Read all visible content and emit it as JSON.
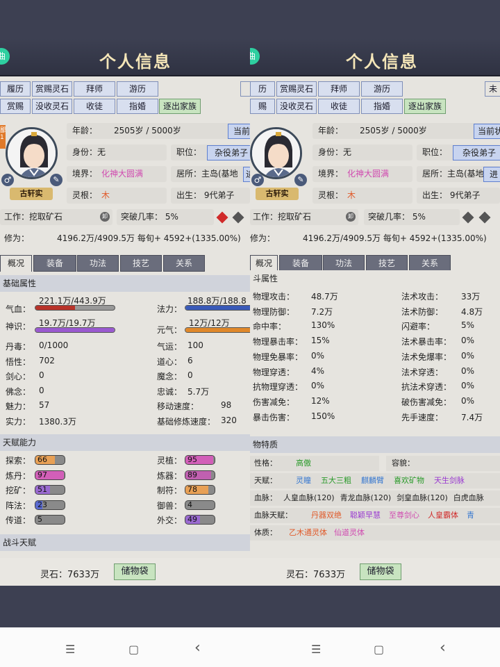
{
  "left": {
    "title": "个人信息",
    "edge_left": "曲",
    "toolbar_row1": [
      "履历",
      "赏赐灵石",
      "拜师",
      "游历"
    ],
    "toolbar_row2": [
      "赏赐",
      "没收灵石",
      "收徒",
      "指婚",
      "逐出家族"
    ],
    "corner_btn": "",
    "badge_left": "鄙",
    "badge_left2": "1",
    "name": "古轩实",
    "gender_icon": "♂",
    "age_label": "年龄：",
    "age_value": "2505岁 / 5000岁",
    "current_btn": "当前",
    "identity": "身份：无",
    "position_label": "职位：",
    "position_value": "杂役弟子",
    "realm_label": "境界：",
    "realm_value": "化神大圆满",
    "residence": "居所：主岛(基地",
    "residence_btn": "进",
    "root_label": "灵根：",
    "root_value": "木",
    "birth": "出生： 9代弟子",
    "work": "工作：挖取矿石",
    "work_icon": "卸",
    "breakthrough": "突破几率： 5%",
    "cultivation_label": "修为：",
    "cultivation_value": "4196.2万/4909.5万 每旬+ 4592+(1335.00%)",
    "tabs": [
      "概况",
      "装备",
      "功法",
      "技艺",
      "关系"
    ],
    "section1": "基础属性",
    "qixue_label": "气血：",
    "qixue_value": "221.1万/443.9万",
    "qixue_fill": 0.5,
    "fali_label": "法力：",
    "fali_value": "188.8万/188.8",
    "fali_fill": 1.0,
    "shenshi_label": "神识：",
    "shenshi_value": "19.7万/19.7万",
    "shenshi_fill": 1.0,
    "yuanqi_label": "元气：",
    "yuanqi_value": "12万/12万",
    "yuanqi_fill": 1.0,
    "attrs_left": [
      {
        "k": "丹毒：",
        "v": "0/1000"
      },
      {
        "k": "悟性：",
        "v": "702"
      },
      {
        "k": "剑心：",
        "v": "0"
      },
      {
        "k": "佛念：",
        "v": "0"
      },
      {
        "k": "魅力：",
        "v": "57"
      },
      {
        "k": "实力：",
        "v": "1380.3万"
      }
    ],
    "attrs_right": [
      {
        "k": "气运：",
        "v": "100"
      },
      {
        "k": "道心：",
        "v": "6"
      },
      {
        "k": "魔念：",
        "v": "0"
      },
      {
        "k": "忠诚：",
        "v": "5.7万"
      },
      {
        "k": "移动速度：",
        "v": "98"
      },
      {
        "k": "基础修炼速度：",
        "v": "320"
      }
    ],
    "section2": "天赋能力",
    "talents_left": [
      {
        "k": "探索：",
        "v": "66",
        "fill": 0.66,
        "color": "#e8a055"
      },
      {
        "k": "炼丹：",
        "v": "97",
        "fill": 0.97,
        "color": "#d25fb8"
      },
      {
        "k": "挖矿：",
        "v": "51",
        "fill": 0.51,
        "color": "#9a6ad0"
      },
      {
        "k": "阵法：",
        "v": "23",
        "fill": 0.23,
        "color": "#5a6ad0"
      },
      {
        "k": "传道：",
        "v": "5",
        "fill": 0.05,
        "color": "#8a8a8a"
      }
    ],
    "talents_right": [
      {
        "k": "灵植：",
        "v": "95",
        "fill": 0.95,
        "color": "#d25fb8"
      },
      {
        "k": "炼器：",
        "v": "89",
        "fill": 0.89,
        "color": "#c060b0"
      },
      {
        "k": "制符：",
        "v": "78",
        "fill": 0.78,
        "color": "#e8a055"
      },
      {
        "k": "御兽：",
        "v": "4",
        "fill": 0.04,
        "color": "#8a8a8a"
      },
      {
        "k": "外交：",
        "v": "49",
        "fill": 0.49,
        "color": "#9a6ad0"
      }
    ],
    "section3": "战斗天赋",
    "stones": "灵石：7633万",
    "bag_btn": "储物袋"
  },
  "right": {
    "title": "个人信息",
    "edge_left": "曲",
    "toolbar_row1": [
      "历",
      "赏赐灵石",
      "拜师",
      "游历"
    ],
    "toolbar_row2": [
      "赐",
      "没收灵石",
      "收徒",
      "指婚",
      "逐出家族"
    ],
    "corner_btn": "未",
    "name": "古轩实",
    "gender_icon": "♂",
    "age_label": "年龄：",
    "age_value": "2505岁 / 5000岁",
    "current_btn": "当前状",
    "identity": "身份：无",
    "position_label": "职位：",
    "position_value": "杂役弟子",
    "realm_label": "境界：",
    "realm_value": "化神大圆满",
    "residence": "居所：主岛(基地",
    "residence_btn": "进",
    "root_label": "灵根：",
    "root_value": "木",
    "birth": "出生： 9代弟子",
    "work": "工作：挖取矿石",
    "work_icon": "卸",
    "breakthrough": "突破几率： 5%",
    "cultivation_label": "修为：",
    "cultivation_value": "4196.2万/4909.5万 每旬+ 4592+(1335.00%)",
    "tabs": [
      "概况",
      "装备",
      "功法",
      "技艺",
      "关系"
    ],
    "section1": "斗属性",
    "combat_left": [
      {
        "k": "物理攻击：",
        "v": "48.7万"
      },
      {
        "k": "物理防御：",
        "v": "7.2万"
      },
      {
        "k": "命中率：",
        "v": "130%"
      },
      {
        "k": "物理暴击率：",
        "v": "15%"
      },
      {
        "k": "物理免暴率：",
        "v": "0%"
      },
      {
        "k": "物理穿透：",
        "v": "4%"
      },
      {
        "k": "抗物理穿透：",
        "v": "0%"
      },
      {
        "k": "伤害减免：",
        "v": "12%"
      },
      {
        "k": "暴击伤害：",
        "v": "150%"
      }
    ],
    "combat_right": [
      {
        "k": "法术攻击：",
        "v": "33万"
      },
      {
        "k": "法术防御：",
        "v": "4.8万"
      },
      {
        "k": "闪避率：",
        "v": "5%"
      },
      {
        "k": "法术暴击率：",
        "v": "0%"
      },
      {
        "k": "法术免爆率：",
        "v": "0%"
      },
      {
        "k": "法术穿透：",
        "v": "0%"
      },
      {
        "k": "抗法术穿透：",
        "v": "0%"
      },
      {
        "k": "破伤害减免：",
        "v": "0%"
      },
      {
        "k": "先手速度：",
        "v": "7.4万"
      }
    ],
    "section2": "物特质",
    "xingge_label": "性格：",
    "xingge_value": "高傲",
    "rongmao_label": "容貌：",
    "tianfu_label": "天赋：",
    "tianfu_items": [
      {
        "t": "灵瞳",
        "c": "#3a7ad0"
      },
      {
        "t": "五大三粗",
        "c": "#2a9a2a"
      },
      {
        "t": "麒麟臂",
        "c": "#3a7ad0"
      },
      {
        "t": "喜欢矿物",
        "c": "#2a9a2a"
      },
      {
        "t": "天生剑脉",
        "c": "#9a3ad0"
      }
    ],
    "xuemai_label": "血脉：",
    "xuemai_items": [
      "人皇血脉(120)",
      "青龙血脉(120)",
      "剑皇血脉(120)",
      "白虎血脉"
    ],
    "xmtf_label": "血脉天赋：",
    "xmtf_items": [
      {
        "t": "丹器双绝",
        "c": "#e05a2a"
      },
      {
        "t": "聪颖早慧",
        "c": "#9a3ad0"
      },
      {
        "t": "至尊剑心",
        "c": "#d04ab0"
      },
      {
        "t": "人皇霸体",
        "c": "#d02a2a"
      },
      {
        "t": "青",
        "c": "#3a7ad0"
      }
    ],
    "tizhi_label": "体质：",
    "tizhi_items": [
      {
        "t": "乙木通灵体",
        "c": "#e05a2a"
      },
      {
        "t": "仙道灵体",
        "c": "#d04ab0"
      }
    ],
    "stones": "灵石：7633万",
    "bag_btn": "储物袋"
  },
  "nav": {
    "menu": "☰",
    "home": "▢",
    "back": "‹"
  }
}
